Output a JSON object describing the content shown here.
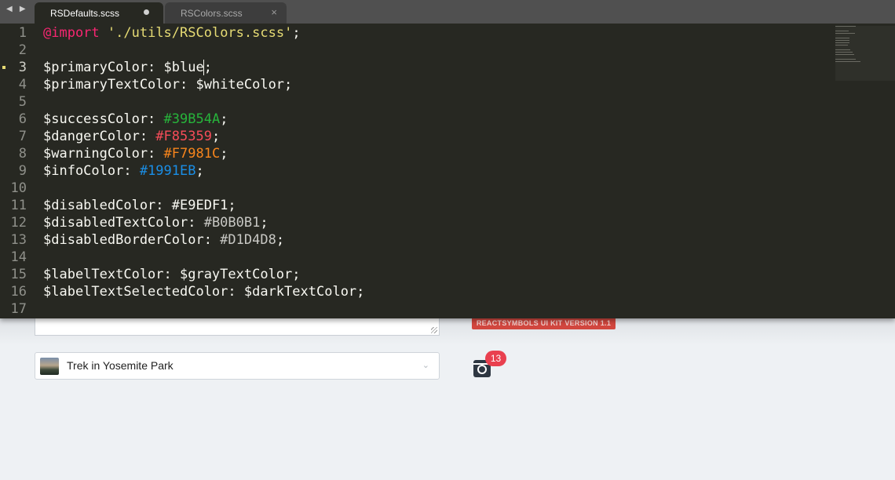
{
  "editor": {
    "nav_arrows": "◀ ▶",
    "tabs": [
      {
        "label": "RSDefaults.scss",
        "active": true,
        "modified": true
      },
      {
        "label": "RSColors.scss",
        "active": false,
        "close": "×"
      }
    ],
    "current_line": 3,
    "lines": [
      {
        "n": "1",
        "tokens": [
          {
            "t": "@import",
            "c": "kw"
          },
          {
            "t": " ",
            "c": "white"
          },
          {
            "t": "'./utils/RSColors.scss'",
            "c": "str"
          },
          {
            "t": ";",
            "c": "white"
          }
        ]
      },
      {
        "n": "2",
        "tokens": []
      },
      {
        "n": "3",
        "tokens": [
          {
            "t": "$primaryColor: $blue",
            "c": "white"
          },
          {
            "t": "|caret|",
            "c": "caret"
          },
          {
            "t": ";",
            "c": "white"
          }
        ]
      },
      {
        "n": "4",
        "tokens": [
          {
            "t": "$primaryTextColor: $whiteColor;",
            "c": "white"
          }
        ]
      },
      {
        "n": "5",
        "tokens": []
      },
      {
        "n": "6",
        "tokens": [
          {
            "t": "$successColor: ",
            "c": "white"
          },
          {
            "t": "#39B54A",
            "c": "green"
          },
          {
            "t": ";",
            "c": "white"
          }
        ]
      },
      {
        "n": "7",
        "tokens": [
          {
            "t": "$dangerColor: ",
            "c": "white"
          },
          {
            "t": "#F85359",
            "c": "red"
          },
          {
            "t": ";",
            "c": "white"
          }
        ]
      },
      {
        "n": "8",
        "tokens": [
          {
            "t": "$warningColor: ",
            "c": "white"
          },
          {
            "t": "#F7981C",
            "c": "orange"
          },
          {
            "t": ";",
            "c": "white"
          }
        ]
      },
      {
        "n": "9",
        "tokens": [
          {
            "t": "$infoColor: ",
            "c": "white"
          },
          {
            "t": "#1991EB",
            "c": "blue"
          },
          {
            "t": ";",
            "c": "white"
          }
        ]
      },
      {
        "n": "10",
        "tokens": []
      },
      {
        "n": "11",
        "tokens": [
          {
            "t": "$disabledColor: ",
            "c": "white"
          },
          {
            "t": "#E9EDF1",
            "c": "white"
          },
          {
            "t": ";",
            "c": "white"
          }
        ]
      },
      {
        "n": "12",
        "tokens": [
          {
            "t": "$disabledTextColor: ",
            "c": "white"
          },
          {
            "t": "#B0B0B1",
            "c": "dim"
          },
          {
            "t": ";",
            "c": "white"
          }
        ]
      },
      {
        "n": "13",
        "tokens": [
          {
            "t": "$disabledBorderColor: ",
            "c": "white"
          },
          {
            "t": "#D1D4D8",
            "c": "dim"
          },
          {
            "t": ";",
            "c": "white"
          }
        ]
      },
      {
        "n": "14",
        "tokens": []
      },
      {
        "n": "15",
        "tokens": [
          {
            "t": "$labelTextColor: $grayTextColor;",
            "c": "white"
          }
        ]
      },
      {
        "n": "16",
        "tokens": [
          {
            "t": "$labelTextSelectedColor: $darkTextColor;",
            "c": "white"
          }
        ]
      },
      {
        "n": "17",
        "tokens": []
      }
    ],
    "colors": {
      "background": "#272822",
      "tabbar": "#505050",
      "keyword": "#F92672",
      "string": "#E6DB74"
    }
  },
  "app": {
    "version_badge": "REACTSYMBOLS UI KIT VERSION 1.1",
    "select": {
      "label": "Trek in Yosemite Park",
      "icon": "chevron-down-icon"
    },
    "notifications": {
      "count": "13",
      "icon": "instagram-icon"
    }
  }
}
